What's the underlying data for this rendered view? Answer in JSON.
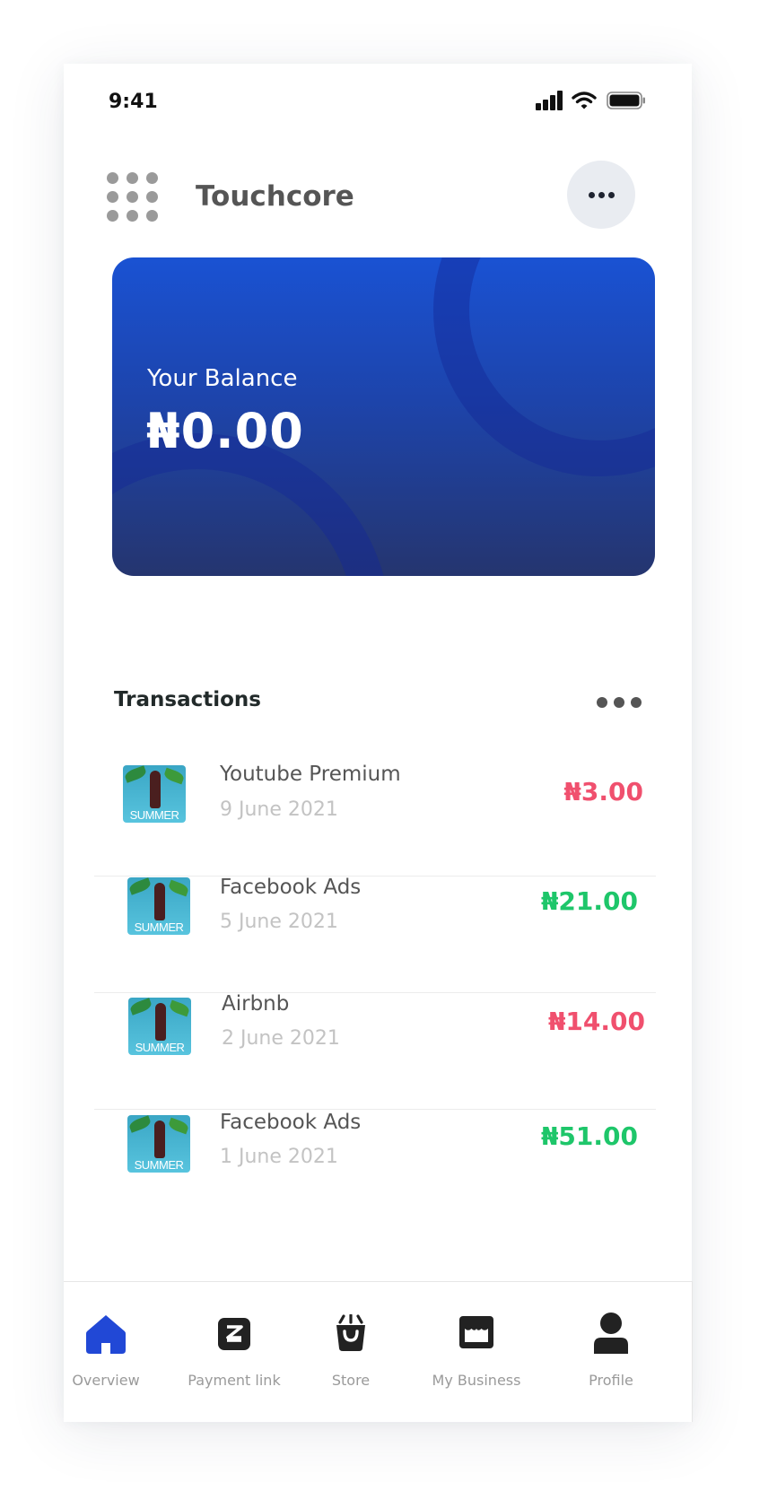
{
  "status_bar": {
    "time": "9:41"
  },
  "header": {
    "title": "Touchcore"
  },
  "balance_card": {
    "label": "Your Balance",
    "value": "₦0.00"
  },
  "transactions": {
    "title": "Transactions",
    "items": [
      {
        "name": "Youtube Premium",
        "date": "9 June 2021",
        "amount": "₦3.00",
        "direction": "debit",
        "thumb_text": "SUMMER"
      },
      {
        "name": "Facebook Ads",
        "date": "5 June 2021",
        "amount": "₦21.00",
        "direction": "credit",
        "thumb_text": "SUMMER"
      },
      {
        "name": "Airbnb",
        "date": "2 June 2021",
        "amount": "₦14.00",
        "direction": "debit",
        "thumb_text": "SUMMER"
      },
      {
        "name": "Facebook Ads",
        "date": "1 June 2021",
        "amount": "₦51.00",
        "direction": "credit",
        "thumb_text": "SUMMER"
      }
    ]
  },
  "bottom_nav": {
    "items": [
      {
        "label": "Overview",
        "icon": "home-icon",
        "active": true
      },
      {
        "label": "Payment link",
        "icon": "link-icon",
        "active": false
      },
      {
        "label": "Store",
        "icon": "shopping-bag-icon",
        "active": false
      },
      {
        "label": "My Business",
        "icon": "storefront-icon",
        "active": false
      },
      {
        "label": "Profile",
        "icon": "person-icon",
        "active": false
      }
    ]
  },
  "colors": {
    "accent": "#2148d6",
    "debit": "#f0506e",
    "credit": "#1ec66a",
    "card_top": "#1a52d3",
    "card_bottom": "#25356f"
  }
}
